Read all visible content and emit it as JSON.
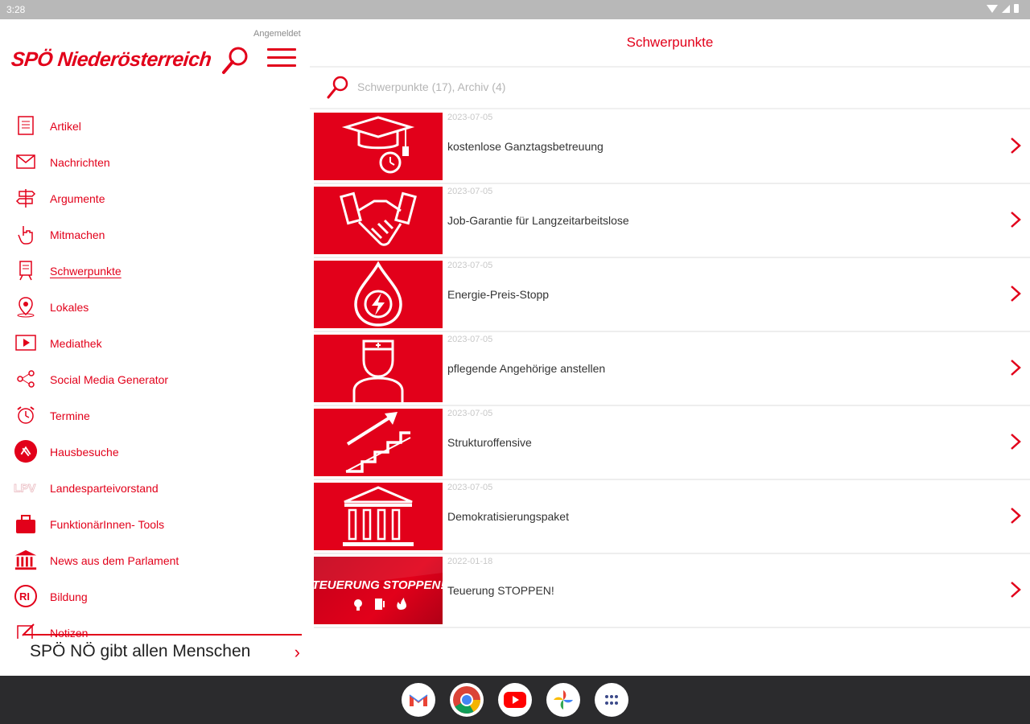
{
  "status_bar": {
    "time": "3:28"
  },
  "sidebar": {
    "logo": "SPÖ Niederösterreich",
    "login_label": "Angemeldet",
    "nav": [
      {
        "label": "Artikel",
        "icon": "article-icon"
      },
      {
        "label": "Nachrichten",
        "icon": "mail-icon"
      },
      {
        "label": "Argumente",
        "icon": "signpost-icon"
      },
      {
        "label": "Mitmachen",
        "icon": "hand-pointer-icon"
      },
      {
        "label": "Schwerpunkte",
        "icon": "presentation-board-icon",
        "active": true
      },
      {
        "label": "Lokales",
        "icon": "location-pin-icon"
      },
      {
        "label": "Mediathek",
        "icon": "video-icon"
      },
      {
        "label": "Social Media Generator",
        "icon": "share-network-icon"
      },
      {
        "label": "Termine",
        "icon": "alarm-clock-icon"
      },
      {
        "label": "Hausbesuche",
        "icon": "house-visit-icon"
      },
      {
        "label": "Landesparteivorstand",
        "icon": "lpv-logo-icon"
      },
      {
        "label": "FunktionärInnen- Tools",
        "icon": "toolbox-icon"
      },
      {
        "label": "News aus dem Parlament",
        "icon": "parliament-icon"
      },
      {
        "label": "Bildung",
        "icon": "education-logo-icon"
      },
      {
        "label": "Notizen",
        "icon": "notes-icon"
      }
    ],
    "ticker": "SPÖ NÖ gibt allen Menschen"
  },
  "main": {
    "title": "Schwerpunkte",
    "search_placeholder": "Schwerpunkte (17), Archiv (4)",
    "items": [
      {
        "date": "2023-07-05",
        "title": "kostenlose Ganztagsbetreuung",
        "thumb": "graduation-cap-icon"
      },
      {
        "date": "2023-07-05",
        "title": "Job-Garantie für Langzeitarbeitslose",
        "thumb": "handshake-icon"
      },
      {
        "date": "2023-07-05",
        "title": "Energie-Preis-Stopp",
        "thumb": "energy-drop-icon"
      },
      {
        "date": "2023-07-05",
        "title": "pflegende Angehörige anstellen",
        "thumb": "nurse-icon"
      },
      {
        "date": "2023-07-05",
        "title": "Strukturoffensive",
        "thumb": "stairs-arrow-icon"
      },
      {
        "date": "2023-07-05",
        "title": "Demokratisierungspaket",
        "thumb": "parliament-building-icon"
      },
      {
        "date": "2022-01-18",
        "title": "Teuerung STOPPEN!",
        "thumb": "teuerung-banner",
        "banner_text": "TEUERUNG STOPPEN!"
      }
    ]
  },
  "dock": {
    "apps": [
      {
        "name": "gmail-icon",
        "glyph": "M"
      },
      {
        "name": "chrome-icon"
      },
      {
        "name": "youtube-icon"
      },
      {
        "name": "photos-icon"
      },
      {
        "name": "app-drawer-icon"
      }
    ]
  },
  "colors": {
    "accent": "#e2001a",
    "dock": "#2b2b2d",
    "status_bar": "#b8b8b8"
  }
}
